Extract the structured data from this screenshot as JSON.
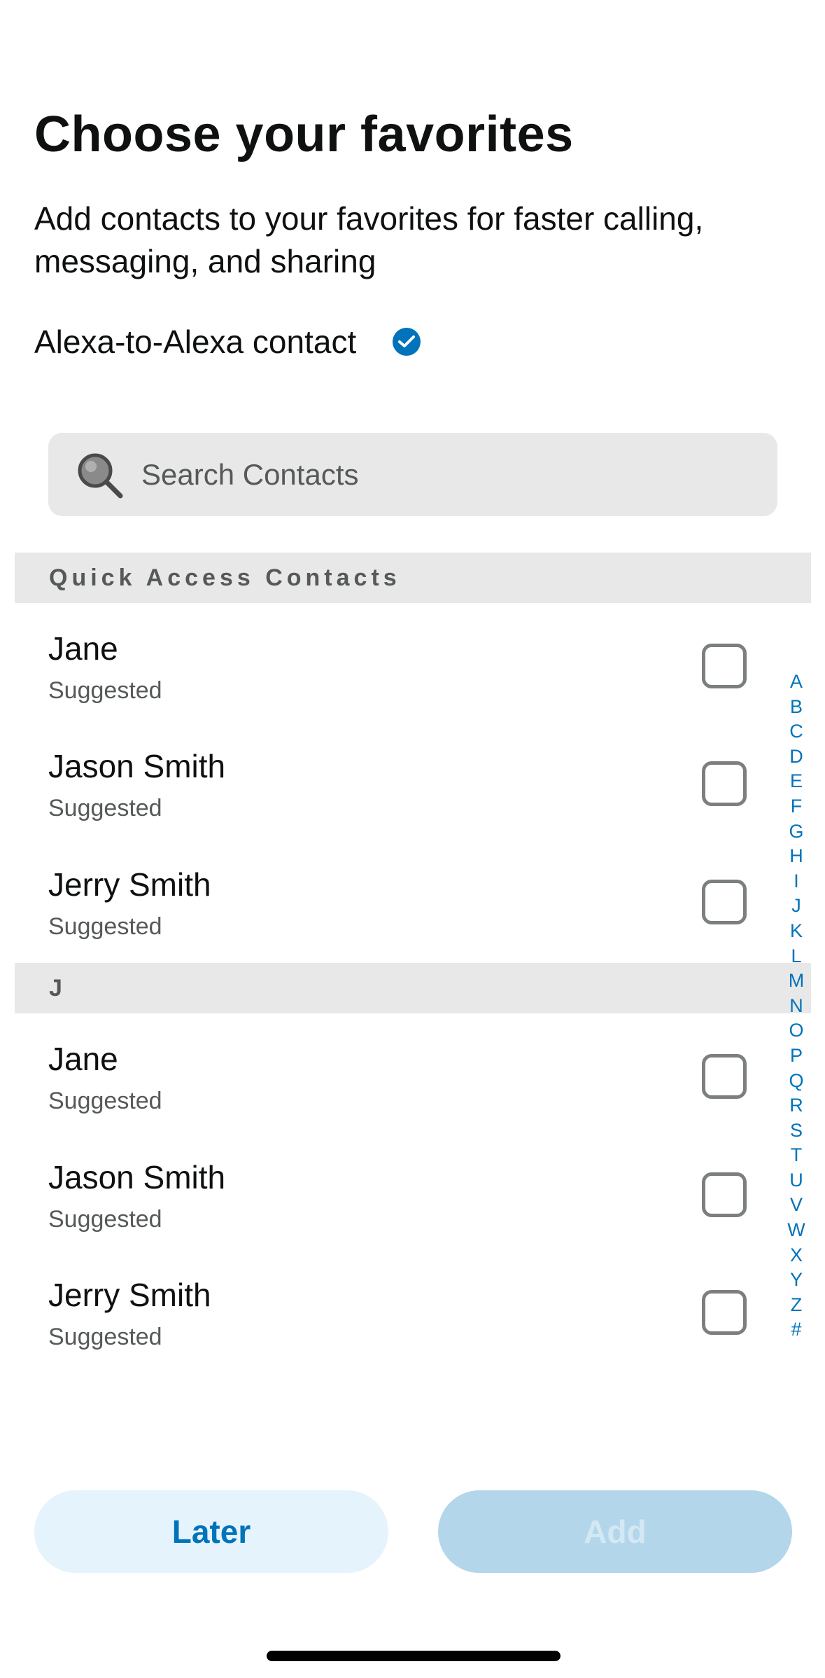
{
  "header": {
    "title": "Choose your favorites",
    "subtitle": "Add contacts to your favorites for faster calling, messaging, and sharing",
    "a2a_label": "Alexa-to-Alexa contact",
    "a2a_icon": "check-circle-icon"
  },
  "search": {
    "placeholder": "Search Contacts",
    "value": "",
    "icon": "search-icon"
  },
  "sections": [
    {
      "header": "Quick Access Contacts",
      "contacts": [
        {
          "name": "Jane",
          "subtitle": "Suggested",
          "checked": false
        },
        {
          "name": "Jason Smith",
          "subtitle": "Suggested",
          "checked": false
        },
        {
          "name": "Jerry Smith",
          "subtitle": "Suggested",
          "checked": false
        }
      ]
    },
    {
      "header": "J",
      "contacts": [
        {
          "name": "Jane",
          "subtitle": "Suggested",
          "checked": false
        },
        {
          "name": "Jason Smith",
          "subtitle": "Suggested",
          "checked": false
        },
        {
          "name": "Jerry Smith",
          "subtitle": "Suggested",
          "checked": false
        }
      ]
    }
  ],
  "alpha_index": [
    "A",
    "B",
    "C",
    "D",
    "E",
    "F",
    "G",
    "H",
    "I",
    "J",
    "K",
    "L",
    "M",
    "N",
    "O",
    "P",
    "Q",
    "R",
    "S",
    "T",
    "U",
    "V",
    "W",
    "X",
    "Y",
    "Z",
    "#"
  ],
  "buttons": {
    "later_label": "Later",
    "add_label": "Add",
    "add_enabled": false
  },
  "colors": {
    "accent": "#0073bb",
    "later_bg": "#e5f4fc",
    "add_bg_disabled": "#b3d6ea",
    "section_bg": "#e8e8e8"
  }
}
